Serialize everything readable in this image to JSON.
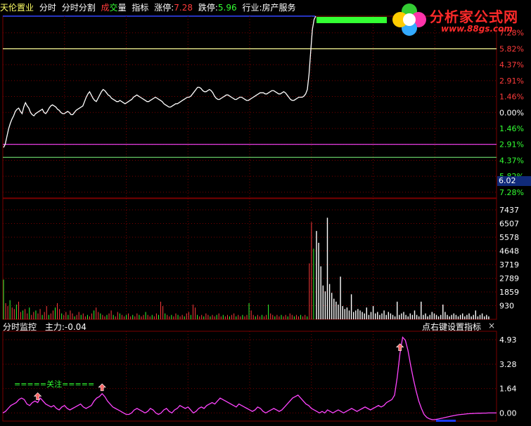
{
  "header": {
    "stock_name": "天伦置业",
    "menu_1": "分时",
    "menu_2": "分时分割",
    "menu_3a": "成",
    "menu_3b": "交",
    "menu_3c": "量",
    "menu_4": "指标",
    "limit_up_label": "涨停:",
    "limit_up_value": "7.28",
    "limit_down_label": "跌停:",
    "limit_down_value": "5.96",
    "industry_label": "行业:",
    "industry_value": "房产服务"
  },
  "logo": {
    "title": "分析家公式网",
    "url": "www.88gs.com"
  },
  "colors": {
    "background": "#000000",
    "grid": "#7a0000",
    "price_line": "#ffffff",
    "ref_yellow": "#ffff99",
    "ref_magenta": "#ff44ff",
    "ref_green": "#66cc66",
    "up": "#ff3b3b",
    "down": "#33ff33",
    "indicator": "#ff44ff"
  },
  "chart_data": [
    {
      "type": "line",
      "panel": "price",
      "ylim": [
        -7.8,
        8.8
      ],
      "right_axis_ticks": [
        "7.28%",
        "5.82%",
        "4.37%",
        "2.91%",
        "1.46%",
        "0.00%",
        "1.46%",
        "2.91%",
        "4.37%",
        "5.82%",
        "7.28%"
      ],
      "right_axis_values": [
        7.28,
        5.82,
        4.37,
        2.91,
        1.46,
        0.0,
        -1.46,
        -2.91,
        -4.37,
        -5.82,
        -7.28
      ],
      "current_price": "6.02",
      "reference_lines": [
        {
          "value": 5.82,
          "color": "#ffff99"
        },
        {
          "value": -2.91,
          "color": "#ff44ff"
        },
        {
          "value": -4.1,
          "color": "#66cc66"
        }
      ],
      "series": [
        {
          "values": [
            -3.2,
            -2.9,
            -2.2,
            -1.5,
            -1.0,
            -0.6,
            -0.3,
            0.1,
            0.3,
            0.4,
            0.1,
            -0.1,
            0.5,
            0.9,
            0.6,
            0.4,
            0.0,
            -0.2,
            -0.3,
            -0.1,
            0.0,
            0.1,
            0.2,
            0.3,
            0.0,
            -0.1,
            0.1,
            0.4,
            0.6,
            0.7,
            0.6,
            0.5,
            0.3,
            0.2,
            0.0,
            -0.1,
            -0.1,
            0.0,
            0.1,
            0.0,
            -0.2,
            -0.2,
            0.0,
            0.2,
            0.3,
            0.4,
            0.5,
            0.6,
            1.0,
            1.4,
            1.7,
            1.9,
            1.6,
            1.3,
            1.1,
            1.0,
            1.3,
            1.6,
            1.9,
            2.1,
            2.0,
            1.8,
            1.6,
            1.5,
            1.3,
            1.2,
            1.1,
            1.0,
            1.0,
            1.1,
            1.0,
            0.9,
            0.8,
            0.9,
            1.0,
            1.1,
            1.2,
            1.4,
            1.5,
            1.6,
            1.5,
            1.4,
            1.3,
            1.2,
            1.1,
            1.0,
            1.0,
            1.1,
            1.2,
            1.3,
            1.4,
            1.3,
            1.2,
            1.1,
            1.0,
            0.8,
            0.7,
            0.6,
            0.5,
            0.5,
            0.6,
            0.7,
            0.8,
            0.8,
            0.9,
            1.0,
            1.1,
            1.2,
            1.3,
            1.4,
            1.4,
            1.5,
            1.7,
            1.9,
            2.1,
            2.3,
            2.3,
            2.2,
            2.0,
            1.9,
            1.9,
            2.0,
            2.1,
            2.0,
            1.8,
            1.5,
            1.3,
            1.2,
            1.2,
            1.3,
            1.4,
            1.5,
            1.6,
            1.6,
            1.5,
            1.4,
            1.3,
            1.2,
            1.2,
            1.3,
            1.4,
            1.4,
            1.3,
            1.2,
            1.1,
            1.1,
            1.2,
            1.3,
            1.4,
            1.5,
            1.6,
            1.7,
            1.8,
            1.8,
            1.8,
            1.7,
            1.7,
            1.8,
            1.9,
            2.0,
            2.0,
            1.9,
            1.8,
            1.7,
            1.7,
            1.8,
            1.9,
            1.8,
            1.6,
            1.4,
            1.2,
            1.1,
            1.1,
            1.2,
            1.3,
            1.4,
            1.4,
            1.4,
            1.5,
            1.7,
            2.1,
            3.5,
            5.6,
            7.6,
            8.5,
            8.8
          ]
        }
      ]
    },
    {
      "type": "bar",
      "panel": "volume",
      "ylim": [
        0,
        8200
      ],
      "right_axis_ticks": [
        "7437",
        "6507",
        "5578",
        "4648",
        "3719",
        "2789",
        "1859",
        "930"
      ],
      "right_axis_values": [
        7437,
        6507,
        5578,
        4648,
        3719,
        2789,
        1859,
        930
      ],
      "series": [
        {
          "name": "up",
          "values": [
            2700,
            1100,
            900,
            1300,
            800,
            700,
            1000,
            1200,
            500,
            600,
            700,
            400,
            800,
            300,
            500,
            600,
            400,
            700,
            300,
            500,
            900,
            300,
            400,
            600,
            800,
            1100,
            700,
            400,
            300,
            500,
            300,
            600,
            400,
            200,
            300,
            500,
            300,
            400,
            200,
            300,
            200,
            400,
            600,
            800,
            500,
            400,
            300,
            200,
            300,
            400,
            600,
            300,
            200,
            500,
            400,
            300,
            200,
            300,
            400,
            200,
            300,
            200,
            400,
            300,
            200,
            300,
            500,
            300,
            200,
            300,
            200,
            400,
            300,
            1200,
            900,
            400,
            300,
            200,
            300,
            200,
            400,
            300,
            200,
            300,
            200,
            400,
            500,
            300,
            1000,
            800,
            300,
            200,
            300,
            200,
            400,
            300,
            200,
            300,
            200,
            300,
            400,
            200,
            300,
            200,
            300,
            200,
            300,
            400,
            200,
            300,
            200,
            300,
            200,
            300,
            1100,
            600,
            300,
            200,
            300,
            200,
            300,
            200,
            300,
            1000,
            400,
            300,
            200,
            300,
            200,
            300,
            200,
            300,
            200,
            400,
            300,
            200,
            300,
            200,
            300,
            200,
            300,
            200,
            3800,
            6600,
            4800
          ]
        },
        {
          "name": "down",
          "values": [
            6000,
            5200,
            3600,
            2300,
            1900,
            6900,
            2400,
            1800,
            1400,
            1200,
            1000,
            2900,
            900,
            700,
            800,
            600,
            1700,
            500,
            600,
            700,
            600,
            500,
            400,
            800,
            300,
            500,
            900,
            400,
            500,
            300,
            400,
            600,
            300,
            500,
            400,
            300,
            200,
            1200,
            300,
            400,
            500,
            300,
            200,
            400,
            300,
            600,
            300,
            200,
            1200,
            300,
            400,
            200,
            300,
            500,
            400,
            300,
            200,
            300,
            1000,
            500,
            300,
            200,
            300,
            400,
            300,
            200,
            300,
            400,
            200,
            300,
            400,
            200,
            300,
            600,
            200,
            300,
            400,
            200,
            300,
            200
          ]
        }
      ]
    },
    {
      "type": "line",
      "panel": "indicator",
      "title": "分时监控",
      "legend_label": "主力:-0.04",
      "annotation": "点右键设置指标",
      "close_glyph": "×",
      "attention_label": "=====关注=====",
      "ylim": [
        -0.55,
        5.5
      ],
      "right_axis_ticks": [
        "4.93",
        "3.28",
        "1.64",
        "0.00"
      ],
      "right_axis_values": [
        4.93,
        3.28,
        1.64,
        0.0
      ],
      "signals": [
        13,
        37,
        148
      ],
      "series": [
        {
          "values": [
            0.0,
            0.1,
            0.3,
            0.5,
            0.6,
            0.7,
            0.9,
            1.0,
            0.9,
            0.6,
            0.5,
            0.7,
            0.8,
            0.7,
            1.0,
            0.8,
            0.6,
            0.5,
            0.4,
            0.5,
            0.3,
            0.2,
            0.4,
            0.5,
            0.3,
            0.2,
            0.3,
            0.4,
            0.5,
            0.6,
            0.4,
            0.3,
            0.4,
            0.5,
            0.8,
            1.0,
            1.1,
            1.3,
            1.1,
            0.8,
            0.6,
            0.4,
            0.3,
            0.2,
            0.1,
            0.0,
            -0.1,
            -0.1,
            0.0,
            0.2,
            0.3,
            0.2,
            0.1,
            0.0,
            0.1,
            0.3,
            0.2,
            0.0,
            -0.1,
            0.0,
            0.2,
            0.3,
            0.1,
            0.0,
            0.2,
            0.3,
            0.5,
            0.4,
            0.3,
            0.4,
            0.2,
            0.0,
            0.1,
            0.3,
            0.4,
            0.3,
            0.5,
            0.6,
            0.7,
            0.6,
            0.8,
            1.0,
            0.9,
            0.8,
            0.7,
            0.6,
            0.5,
            0.4,
            0.6,
            0.5,
            0.4,
            0.3,
            0.2,
            0.1,
            0.2,
            0.4,
            0.3,
            0.1,
            0.0,
            0.1,
            0.2,
            0.3,
            0.2,
            0.1,
            0.2,
            0.4,
            0.6,
            0.8,
            1.0,
            1.1,
            1.2,
            1.0,
            0.8,
            0.6,
            0.5,
            0.3,
            0.2,
            0.1,
            0.0,
            0.1,
            0.0,
            0.2,
            0.1,
            0.0,
            0.1,
            0.2,
            0.1,
            0.0,
            0.1,
            0.2,
            0.3,
            0.2,
            0.1,
            0.2,
            0.3,
            0.4,
            0.3,
            0.2,
            0.3,
            0.4,
            0.5,
            0.4,
            0.5,
            0.7,
            0.8,
            0.9,
            1.2,
            2.4,
            4.0,
            5.1,
            4.9,
            4.2,
            3.2,
            2.3,
            1.5,
            0.8,
            0.3,
            -0.1,
            -0.3,
            -0.4,
            -0.45,
            -0.45,
            -0.42,
            -0.38,
            -0.34,
            -0.3,
            -0.26,
            -0.22,
            -0.18,
            -0.15,
            -0.12,
            -0.1,
            -0.08,
            -0.06,
            -0.05,
            -0.04,
            -0.03,
            -0.02,
            -0.02,
            -0.01,
            -0.01,
            0.0,
            0.0,
            0.0,
            0.0
          ]
        }
      ]
    }
  ]
}
